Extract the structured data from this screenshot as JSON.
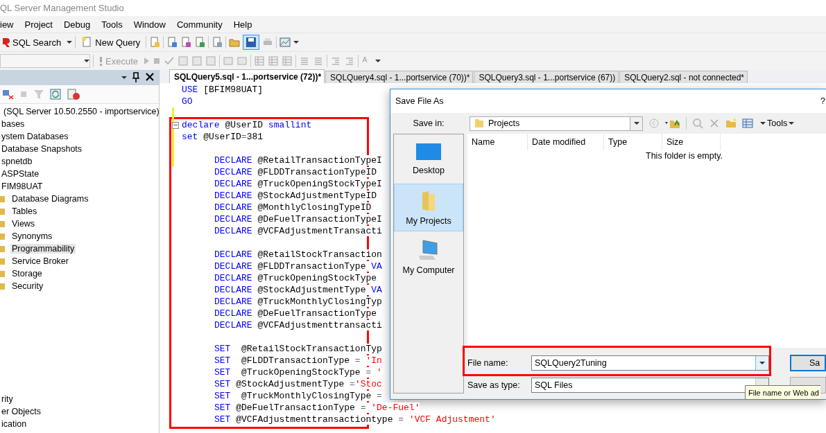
{
  "window": {
    "title": "QL Server Management Studio"
  },
  "menu": [
    "iew",
    "Project",
    "Debug",
    "Tools",
    "Window",
    "Community",
    "Help"
  ],
  "toolbar": {
    "sql_search": "SQL Search",
    "new_query": "New Query"
  },
  "query_toolbar": {
    "execute": {
      "label": "Execute",
      "disabled": true
    }
  },
  "object_explorer": {
    "tree": [
      {
        "label": "(SQL Server 10.50.2550 - importservice)",
        "selected": false,
        "children": [
          {
            "label": "bases",
            "selected": false,
            "children": [
              {
                "label": "ystem Databases",
                "selected": false
              },
              {
                "label": "Database Snapshots",
                "selected": false
              },
              {
                "label": "spnetdb",
                "selected": false
              },
              {
                "label": "ASPState",
                "selected": false
              },
              {
                "label": "FIM98UAT",
                "selected": false,
                "children": [
                  {
                    "label": "Database Diagrams",
                    "selected": false
                  },
                  {
                    "label": "Tables",
                    "selected": false
                  },
                  {
                    "label": "Views",
                    "selected": false
                  },
                  {
                    "label": "Synonyms",
                    "selected": false
                  },
                  {
                    "label": "Programmability",
                    "selected": true
                  },
                  {
                    "label": "Service Broker",
                    "selected": false
                  },
                  {
                    "label": "Storage",
                    "selected": false
                  },
                  {
                    "label": "Security",
                    "selected": false
                  }
                ]
              }
            ]
          },
          {
            "label": "rity",
            "selected": false
          },
          {
            "label": "er Objects",
            "selected": false
          },
          {
            "label": "ication",
            "selected": false
          }
        ]
      }
    ]
  },
  "editor": {
    "tabs": [
      {
        "label": "SQLQuery5.sql - 1...portservice (72))*",
        "selected": true
      },
      {
        "label": "SQLQuery4.sql - 1...portservice (70))*",
        "selected": false
      },
      {
        "label": "SQLQuery3.sql - 1...portservice (67))",
        "selected": false
      },
      {
        "label": "SQLQuery2.sql - not connected*",
        "selected": false
      }
    ],
    "lines": [
      {
        "kind": "code",
        "tokens": [
          {
            "kind": "keyword",
            "text": "USE"
          },
          {
            "kind": "plain",
            "text": " [BFIM98UAT]"
          }
        ]
      },
      {
        "kind": "code",
        "tokens": [
          {
            "kind": "keyword",
            "text": "GO"
          }
        ]
      },
      {
        "kind": "blank",
        "changed": true
      },
      {
        "kind": "code",
        "changed": true,
        "fold": true,
        "tokens": [
          {
            "kind": "keyword",
            "text": "declare"
          },
          {
            "kind": "plain",
            "text": " @UserID "
          },
          {
            "kind": "keyword",
            "text": "smallint"
          }
        ]
      },
      {
        "kind": "code",
        "changed": true,
        "tokens": [
          {
            "kind": "keyword",
            "text": "set"
          },
          {
            "kind": "plain",
            "text": " @UserID"
          },
          {
            "kind": "operator",
            "text": "="
          },
          {
            "kind": "plain",
            "text": "381"
          }
        ]
      },
      {
        "kind": "blank",
        "changed": true
      },
      {
        "kind": "code",
        "changed": true,
        "indented": true,
        "tokens": [
          {
            "kind": "keyword",
            "text": "DECLARE"
          },
          {
            "kind": "plain",
            "text": " @RetailTransactionTypeI"
          }
        ]
      },
      {
        "kind": "code",
        "indented": true,
        "tokens": [
          {
            "kind": "keyword",
            "text": "DECLARE"
          },
          {
            "kind": "plain",
            "text": " @FLDDTransactionTypeID"
          }
        ]
      },
      {
        "kind": "code",
        "indented": true,
        "tokens": [
          {
            "kind": "keyword",
            "text": "DECLARE"
          },
          {
            "kind": "plain",
            "text": " @TruckOpeningStockTypeI"
          }
        ]
      },
      {
        "kind": "code",
        "indented": true,
        "tokens": [
          {
            "kind": "keyword",
            "text": "DECLARE"
          },
          {
            "kind": "plain",
            "text": " @StockAdjustmentTypeID"
          }
        ]
      },
      {
        "kind": "code",
        "indented": true,
        "tokens": [
          {
            "kind": "keyword",
            "text": "DECLARE"
          },
          {
            "kind": "plain",
            "text": " @MonthlyClosingTypeID"
          }
        ]
      },
      {
        "kind": "code",
        "indented": true,
        "tokens": [
          {
            "kind": "keyword",
            "text": "DECLARE"
          },
          {
            "kind": "plain",
            "text": " @DeFuelTransactionTypeI"
          }
        ]
      },
      {
        "kind": "code",
        "indented": true,
        "tokens": [
          {
            "kind": "keyword",
            "text": "DECLARE"
          },
          {
            "kind": "plain",
            "text": " @VCFAdjustmentTransacti"
          }
        ]
      },
      {
        "kind": "blank"
      },
      {
        "kind": "code",
        "indented": true,
        "tokens": [
          {
            "kind": "keyword",
            "text": "DECLARE"
          },
          {
            "kind": "plain",
            "text": " @RetailStockTransaction"
          }
        ]
      },
      {
        "kind": "code",
        "indented": true,
        "tokens": [
          {
            "kind": "keyword",
            "text": "DECLARE"
          },
          {
            "kind": "plain",
            "text": " @FLDDTransactionType "
          },
          {
            "kind": "keyword",
            "text": "VA"
          }
        ]
      },
      {
        "kind": "code",
        "indented": true,
        "tokens": [
          {
            "kind": "keyword",
            "text": "DECLARE"
          },
          {
            "kind": "plain",
            "text": " @TruckOpeningStockType"
          }
        ]
      },
      {
        "kind": "code",
        "indented": true,
        "tokens": [
          {
            "kind": "keyword",
            "text": "DECLARE"
          },
          {
            "kind": "plain",
            "text": " @StockAdjustmentType "
          },
          {
            "kind": "keyword",
            "text": "VA"
          }
        ]
      },
      {
        "kind": "code",
        "indented": true,
        "tokens": [
          {
            "kind": "keyword",
            "text": "DECLARE"
          },
          {
            "kind": "plain",
            "text": " @TruckMonthlyClosingTyp"
          }
        ]
      },
      {
        "kind": "code",
        "indented": true,
        "tokens": [
          {
            "kind": "keyword",
            "text": "DECLARE"
          },
          {
            "kind": "plain",
            "text": " @DeFuelTransactionType"
          }
        ]
      },
      {
        "kind": "code",
        "indented": true,
        "tokens": [
          {
            "kind": "keyword",
            "text": "DECLARE"
          },
          {
            "kind": "plain",
            "text": " @VCFAdjustmenttransacti"
          }
        ]
      },
      {
        "kind": "blank"
      },
      {
        "kind": "code",
        "indented": true,
        "tokens": [
          {
            "kind": "keyword",
            "text": "SET"
          },
          {
            "kind": "plain",
            "text": "  @RetailStockTransactionTyp"
          }
        ]
      },
      {
        "kind": "code",
        "indented": true,
        "tokens": [
          {
            "kind": "keyword",
            "text": "SET"
          },
          {
            "kind": "plain",
            "text": "  @FLDDTransactionType "
          },
          {
            "kind": "operator",
            "text": "= "
          },
          {
            "kind": "string",
            "text": "'In"
          }
        ]
      },
      {
        "kind": "code",
        "indented": true,
        "tokens": [
          {
            "kind": "keyword",
            "text": "SET"
          },
          {
            "kind": "plain",
            "text": "  @TruckOpeningStockType "
          },
          {
            "kind": "operator",
            "text": "= "
          },
          {
            "kind": "string",
            "text": "'"
          }
        ]
      },
      {
        "kind": "code",
        "indented": true,
        "tokens": [
          {
            "kind": "keyword",
            "text": "SET"
          },
          {
            "kind": "plain",
            "text": " @StockAdjustmentType "
          },
          {
            "kind": "operator",
            "text": "="
          },
          {
            "kind": "string",
            "text": "'Stoc"
          }
        ]
      },
      {
        "kind": "code",
        "indented": true,
        "tokens": [
          {
            "kind": "keyword",
            "text": "SET"
          },
          {
            "kind": "plain",
            "text": "  @TruckMonthlyClosingType "
          },
          {
            "kind": "operator",
            "text": "="
          }
        ]
      },
      {
        "kind": "code",
        "indented": true,
        "tokens": [
          {
            "kind": "keyword",
            "text": "SET"
          },
          {
            "kind": "plain",
            "text": " @DeFuelTransactionType "
          },
          {
            "kind": "operator",
            "text": "= "
          },
          {
            "kind": "string",
            "text": "'De-Fuel'"
          }
        ]
      },
      {
        "kind": "code",
        "indented": true,
        "tokens": [
          {
            "kind": "keyword",
            "text": "SET"
          },
          {
            "kind": "plain",
            "text": " @VCFAdjustmenttransactiontype "
          },
          {
            "kind": "operator",
            "text": "= "
          },
          {
            "kind": "string",
            "text": "'VCF Adjustment'"
          }
        ]
      }
    ]
  },
  "dialog": {
    "title": "Save File As",
    "help": "?",
    "save_in": {
      "label": "Save in:",
      "value": "Projects"
    },
    "tools": "Tools",
    "places": [
      {
        "label": "Desktop",
        "kind": "desktop",
        "selected": false
      },
      {
        "label": "My Projects",
        "kind": "folder",
        "selected": true
      },
      {
        "label": "My Computer",
        "kind": "computer",
        "selected": false
      }
    ],
    "columns": [
      "Name",
      "Date modified",
      "Type",
      "Size"
    ],
    "empty_message": "This folder is empty.",
    "file_name": {
      "label": "File name:",
      "value": "SQLQuery2Tuning"
    },
    "save_as_type": {
      "label": "Save as type:",
      "value": "SQL Files"
    },
    "save_button": "Sa",
    "tooltip": "File name or Web ad"
  }
}
